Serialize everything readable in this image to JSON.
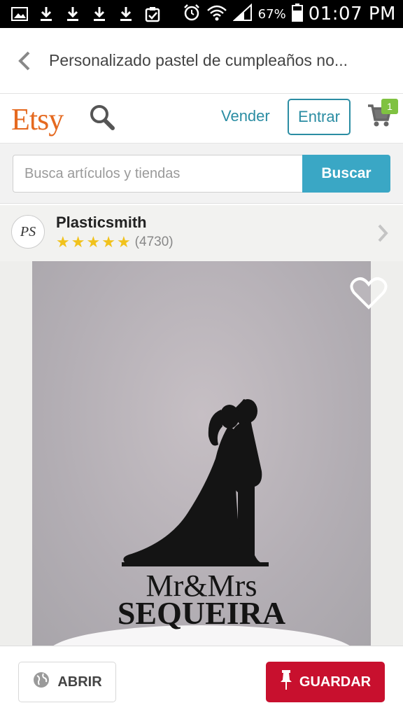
{
  "status_bar": {
    "battery_percent": "67%",
    "time": "01:07 PM",
    "icons": [
      "image-icon",
      "download-icon",
      "download-icon",
      "download-icon",
      "download-icon",
      "clipboard-check-icon",
      "alarm-icon",
      "wifi-icon",
      "signal-icon",
      "battery-icon"
    ]
  },
  "header": {
    "title": "Personalizado pastel de cumpleaños no..."
  },
  "etsy_bar": {
    "logo": "Etsy",
    "sell_label": "Vender",
    "signin_label": "Entrar",
    "cart_count": "1"
  },
  "search": {
    "placeholder": "Busca artículos y tiendas",
    "button_label": "Buscar"
  },
  "shop": {
    "avatar_monogram": "PS",
    "name": "Plasticsmith",
    "rating_stars": 5,
    "review_count": "(4730)"
  },
  "listing_image": {
    "topper_line1": "Mr&Mrs",
    "topper_line2": "SEQUEIRA"
  },
  "actions": {
    "open_label": "ABRIR",
    "save_label": "GUARDAR"
  },
  "colors": {
    "etsy_orange": "#e5691f",
    "teal": "#2b8da3",
    "search_button": "#3aa7c5",
    "star": "#f1c21b",
    "save_red": "#c8102e",
    "cart_badge": "#7fc241"
  }
}
